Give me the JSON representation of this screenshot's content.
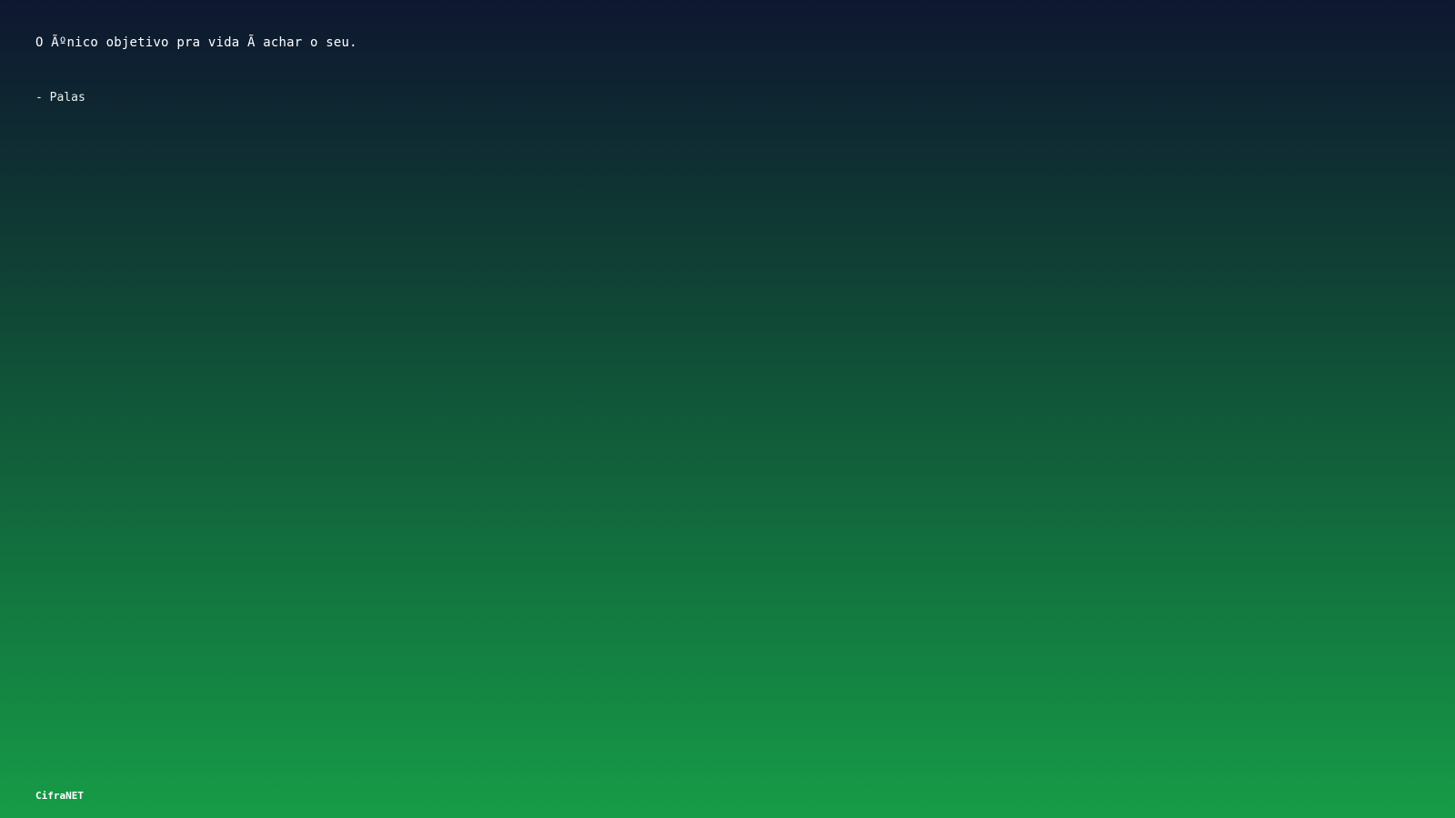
{
  "quote": {
    "text": "O Ãºnico objetivo pra vida Ã achar o seu.",
    "author": "- Palas"
  },
  "footer": {
    "brand": "CifraNET"
  },
  "colors": {
    "gradient_top": "#0e1730",
    "gradient_bottom": "#169c47",
    "text": "#ffffff"
  }
}
